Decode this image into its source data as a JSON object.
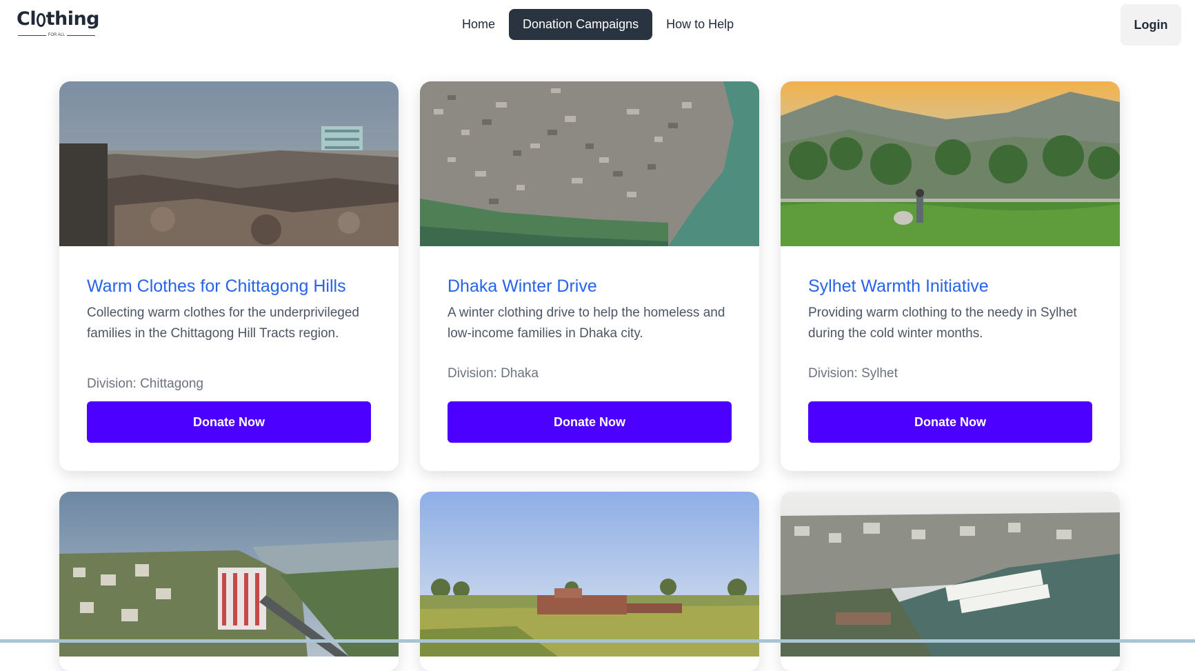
{
  "brand": {
    "logo_text_pre": "Cl",
    "logo_text_post": "thing",
    "logo_sub": "FOR ALL"
  },
  "nav": {
    "links": [
      {
        "label": "Home"
      },
      {
        "label": "Donation Campaigns"
      },
      {
        "label": "How to Help"
      }
    ],
    "login_label": "Login"
  },
  "campaigns": [
    {
      "title": "Warm Clothes for Chittagong Hills",
      "description": "Collecting warm clothes for the underprivileged families in the Chittagong Hill Tracts region.",
      "division": "Division: Chittagong",
      "button": "Donate Now"
    },
    {
      "title": "Dhaka Winter Drive",
      "description": "A winter clothing drive to help the homeless and low-income families in Dhaka city.",
      "division": "Division: Dhaka",
      "button": "Donate Now"
    },
    {
      "title": "Sylhet Warmth Initiative",
      "description": "Providing warm clothing to the needy in Sylhet during the cold winter months.",
      "division": "Division: Sylhet",
      "button": "Donate Now"
    }
  ],
  "colors": {
    "accent": "#4c00ff",
    "title": "#2563eb",
    "nav_active": "#2a3441"
  }
}
